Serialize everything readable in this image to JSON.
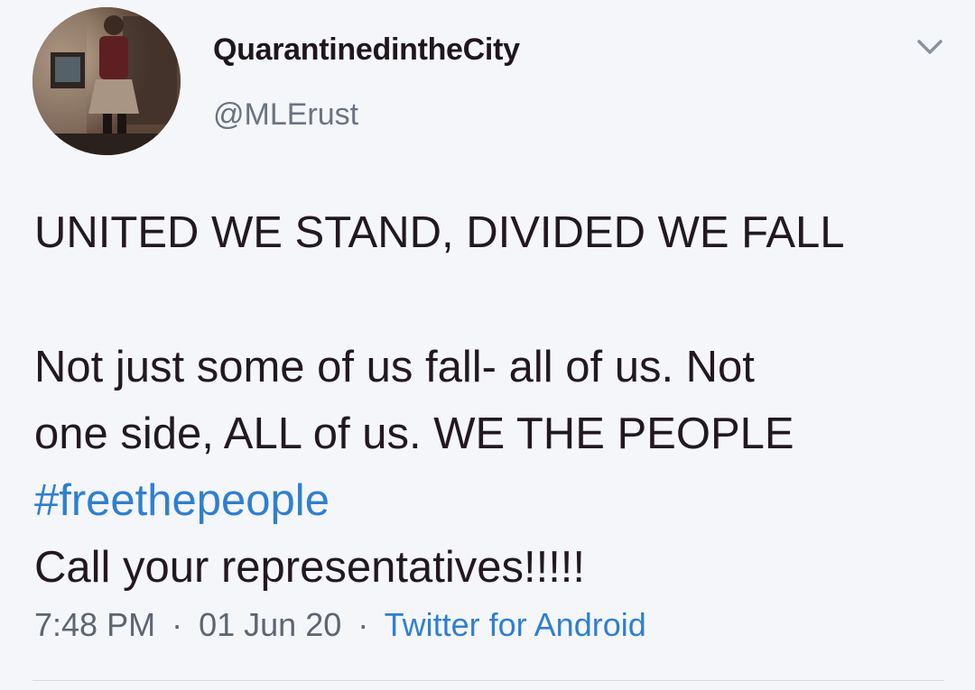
{
  "tweet": {
    "display_name": "QuarantinedintheCity",
    "handle": "@MLErust",
    "body": {
      "line1": "UNITED WE STAND, DIVIDED WE FALL",
      "line2": "Not just some of us fall- all of us. Not",
      "line3": "one side, ALL of us. WE THE PEOPLE",
      "hashtag": "#freethepeople",
      "line5": "Call your representatives!!!!!"
    },
    "meta": {
      "time": "7:48 PM",
      "separator": "·",
      "date": "01 Jun 20",
      "source": "Twitter for Android"
    }
  },
  "icons": {
    "avatar": "profile-photo",
    "menu": "chevron-down-icon"
  },
  "colors": {
    "background": "#f5f6fa",
    "link": "#2f7fd0",
    "text": "#22191f",
    "secondary": "#6b7380"
  }
}
